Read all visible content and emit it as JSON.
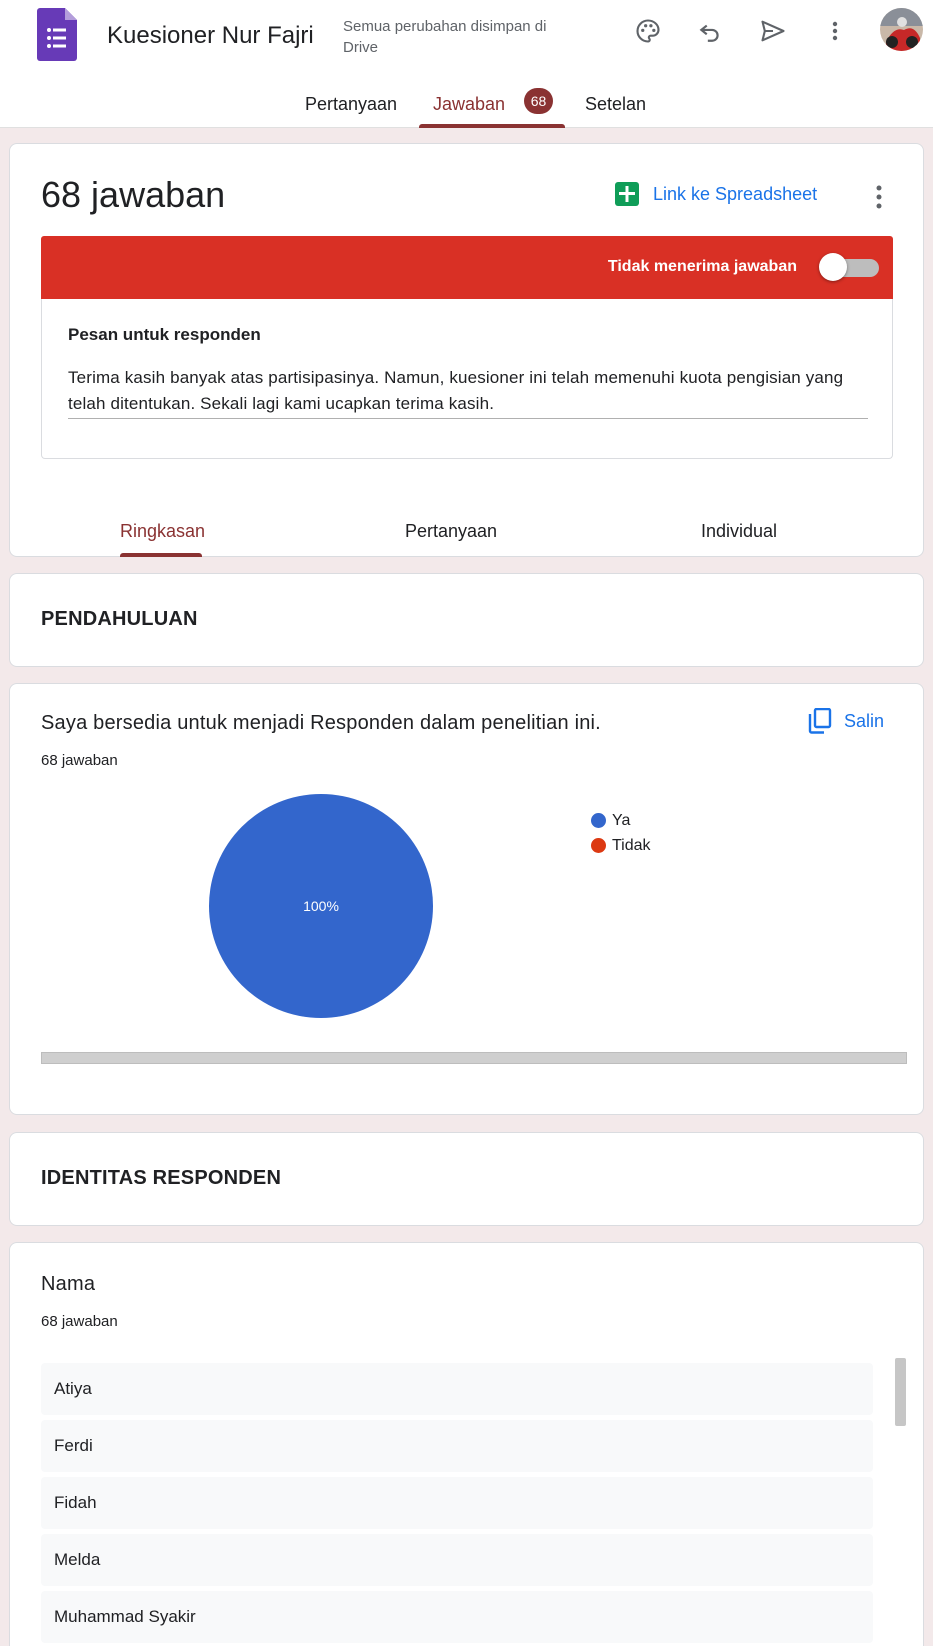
{
  "header": {
    "title": "Kuesioner Nur Fajri",
    "save_status": "Semua perubahan disimpan di Drive"
  },
  "main_tabs": {
    "questions": "Pertanyaan",
    "responses": "Jawaban",
    "responses_badge": "68",
    "settings": "Setelan"
  },
  "summary": {
    "count_label": "68 jawaban",
    "sheet_link": "Link ke Spreadsheet",
    "accepting_label": "Tidak menerima jawaban",
    "accepting_on": false,
    "message_label": "Pesan untuk responden",
    "message_text": "Terima kasih banyak atas partisipasinya. Namun, kuesioner ini telah memenuhi kuota pengisian yang telah ditentukan. Sekali lagi kami ucapkan terima kasih.",
    "tabs": [
      "Ringkasan",
      "Pertanyaan",
      "Individual"
    ]
  },
  "sections": {
    "intro": "PENDAHULUAN",
    "identity": "IDENTITAS RESPONDEN"
  },
  "q1": {
    "title": "Saya bersedia untuk menjadi Responden dalam penelitian ini.",
    "count": "68 jawaban",
    "copy_label": "Salin",
    "legend": [
      {
        "label": "Ya",
        "color": "#3366cc"
      },
      {
        "label": "Tidak",
        "color": "#dc3912"
      }
    ]
  },
  "chart_data": {
    "type": "pie",
    "categories": [
      "Ya",
      "Tidak"
    ],
    "values": [
      100,
      0
    ],
    "data_labels": [
      "100%"
    ],
    "colors": [
      "#3366cc",
      "#dc3912"
    ]
  },
  "q2": {
    "title": "Nama",
    "count": "68 jawaban",
    "answers": [
      "Atiya",
      "Ferdi",
      "Fidah",
      "Melda",
      "Muhammad Syakir"
    ]
  },
  "colors": {
    "accent": "#8a3232",
    "link_blue": "#1a73e8",
    "warning_red": "#d93025",
    "sheets_green": "#0f9d58",
    "forms_purple": "#673ab7"
  }
}
